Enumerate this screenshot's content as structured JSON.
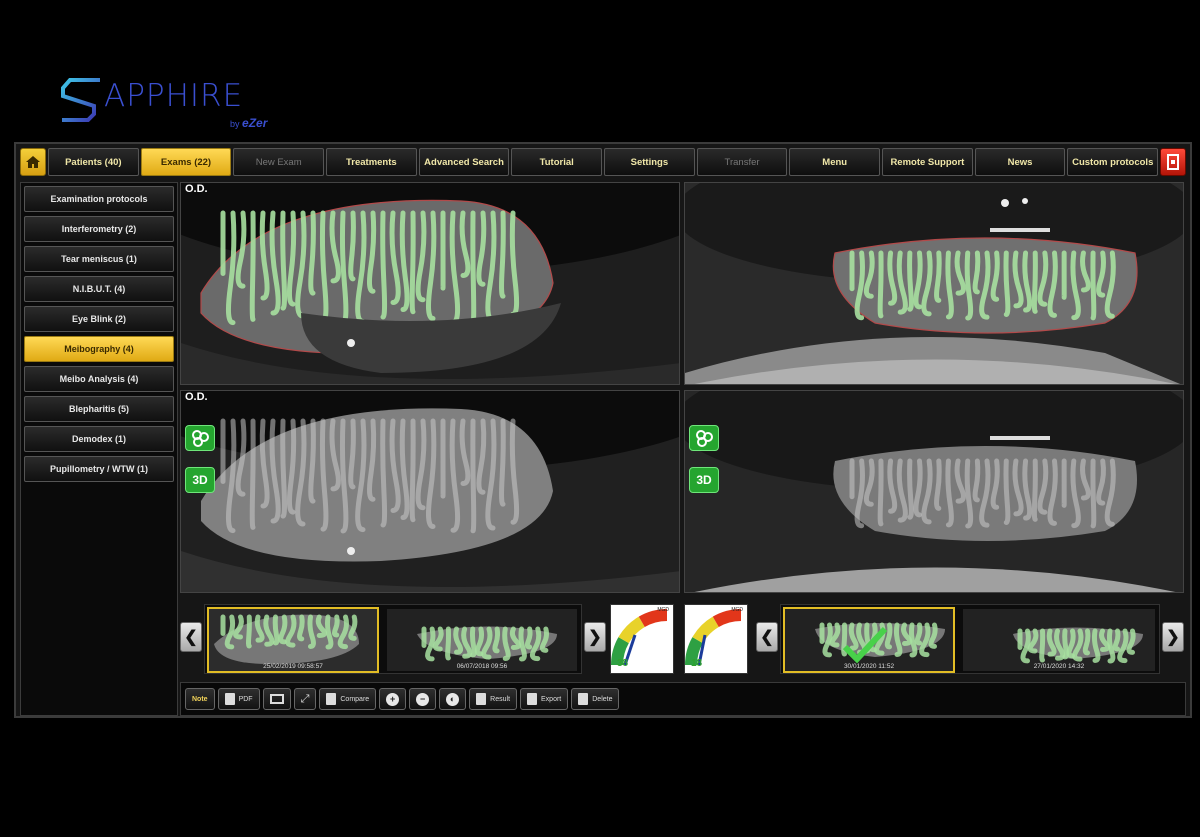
{
  "logo": {
    "wordmark": "APPHIRE",
    "byline_prefix": "by",
    "byline_brand": "eZer"
  },
  "nav": {
    "tabs": [
      {
        "label": "Patients (40)",
        "state": "normal"
      },
      {
        "label": "Exams (22)",
        "state": "active"
      },
      {
        "label": "New Exam",
        "state": "disabled"
      },
      {
        "label": "Treatments",
        "state": "normal"
      },
      {
        "label": "Advanced Search",
        "state": "normal"
      },
      {
        "label": "Tutorial",
        "state": "normal"
      },
      {
        "label": "Settings",
        "state": "normal"
      },
      {
        "label": "Transfer",
        "state": "disabled"
      },
      {
        "label": "Menu",
        "state": "normal"
      },
      {
        "label": "Remote Support",
        "state": "normal"
      },
      {
        "label": "News",
        "state": "normal"
      },
      {
        "label": "Custom protocols",
        "state": "normal"
      }
    ]
  },
  "sidebar": {
    "items": [
      {
        "label": "Examination protocols",
        "active": false
      },
      {
        "label": "Interferometry (2)",
        "active": false
      },
      {
        "label": "Tear meniscus (1)",
        "active": false
      },
      {
        "label": "N.I.B.U.T. (4)",
        "active": false
      },
      {
        "label": "Eye Blink (2)",
        "active": false
      },
      {
        "label": "Meibography (4)",
        "active": true
      },
      {
        "label": "Meibo Analysis (4)",
        "active": false
      },
      {
        "label": "Blepharitis (5)",
        "active": false
      },
      {
        "label": "Demodex (1)",
        "active": false
      },
      {
        "label": "Pupillometry / WTW (1)",
        "active": false
      }
    ]
  },
  "panels": {
    "top_left_label": "O.D.",
    "bottom_left_label": "O.D.",
    "btn_3d": "3D"
  },
  "thumbnails": {
    "left": [
      {
        "date": "25/02/2019 09:58:57",
        "selected": true
      },
      {
        "date": "06/07/2018 09:56",
        "selected": false
      }
    ],
    "right": [
      {
        "date": "30/01/2020 11:52",
        "selected": true
      },
      {
        "date": "27/01/2020 14:32",
        "selected": false
      }
    ]
  },
  "gauges": [
    {
      "value": "38",
      "unit": "MGD"
    },
    {
      "value": "18",
      "unit": "MGD"
    }
  ],
  "toolbar": {
    "note": "Note",
    "pdf": "PDF",
    "compare": "Compare",
    "result": "Result",
    "export": "Export",
    "delete": "Delete"
  },
  "colors": {
    "accent": "#e0aa14",
    "brand": "#3a4fd0",
    "gland_overlay": "#a7e0a0",
    "exit": "#d6271a"
  }
}
